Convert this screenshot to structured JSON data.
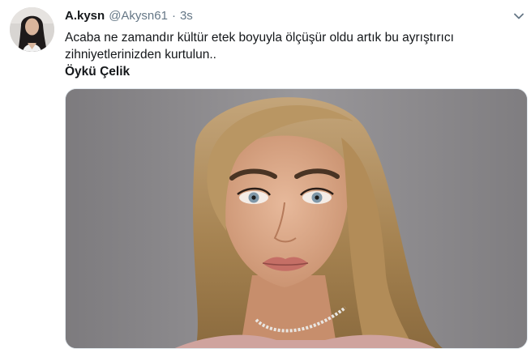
{
  "tweet": {
    "display_name": "A.kysn",
    "handle": "@Akysn61",
    "separator": "·",
    "timestamp": "3s",
    "text_line_1": "Acaba ne zamandır kültür etek boyuyla ölçüşür oldu artık bu ayrıştırıcı",
    "text_line_2": "zihniyetlerinizden kurtulun..",
    "text_line_3": "Öykü Çelik",
    "more_icon": "chevron-down-icon",
    "avatar": "user-avatar-photo",
    "media": "attached-photo-portrait"
  },
  "colors": {
    "text": "#14171a",
    "secondary": "#657786",
    "border": "#e1e8ed",
    "photo_background": "#8e8c8f",
    "hair": "#b08a55"
  }
}
